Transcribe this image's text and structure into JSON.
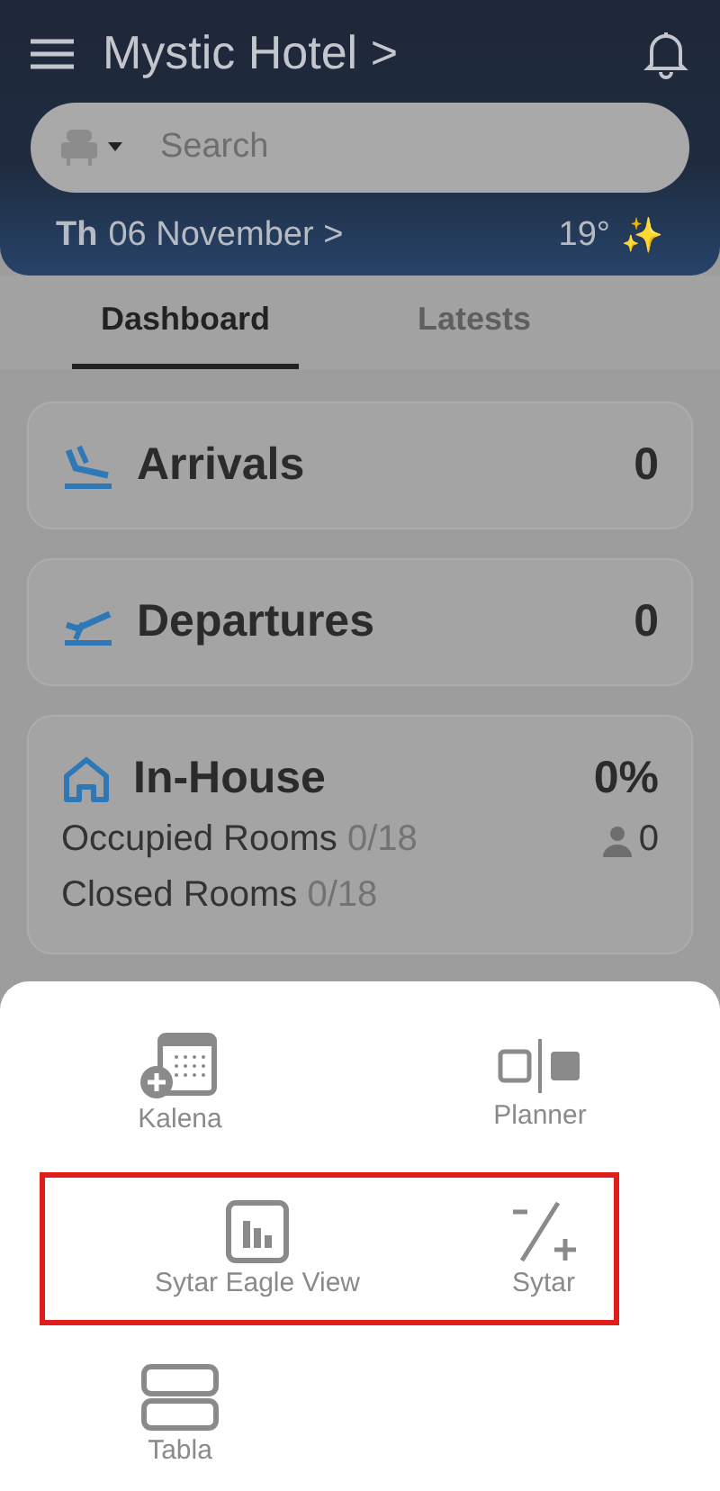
{
  "header": {
    "title": "Mystic Hotel",
    "title_chevron": ">",
    "search": {
      "placeholder": "Search"
    },
    "date": {
      "weekday": "Th",
      "day": "06 November",
      "chevron": ">"
    },
    "weather": "19°",
    "weather_icon": "✨"
  },
  "tabs": [
    {
      "label": "Dashboard",
      "selected": true
    },
    {
      "label": "Latests",
      "selected": false
    }
  ],
  "cards": [
    {
      "kind": "arrivals",
      "title": "Arrivals",
      "value": "0"
    },
    {
      "kind": "departures",
      "title": "Departures",
      "value": "0"
    },
    {
      "kind": "inhouse",
      "title": "In-House",
      "value": "0%",
      "lines": [
        {
          "label": "Occupied Rooms",
          "count": "0/18",
          "guests": "0"
        },
        {
          "label": "Closed Rooms",
          "count": "0/18"
        }
      ]
    }
  ],
  "sheet": {
    "rows": [
      {
        "highlighted": false,
        "items": [
          {
            "kind": "calendar",
            "label": "Kalena"
          },
          {
            "kind": "planner",
            "label": "Planner"
          }
        ]
      },
      {
        "highlighted": true,
        "items": [
          {
            "kind": "chart",
            "label": "Sytar Eagle View"
          },
          {
            "kind": "plusminus",
            "label": "Sytar"
          }
        ]
      },
      {
        "highlighted": false,
        "items": [
          {
            "kind": "table",
            "label": "Tabla"
          }
        ]
      }
    ]
  }
}
